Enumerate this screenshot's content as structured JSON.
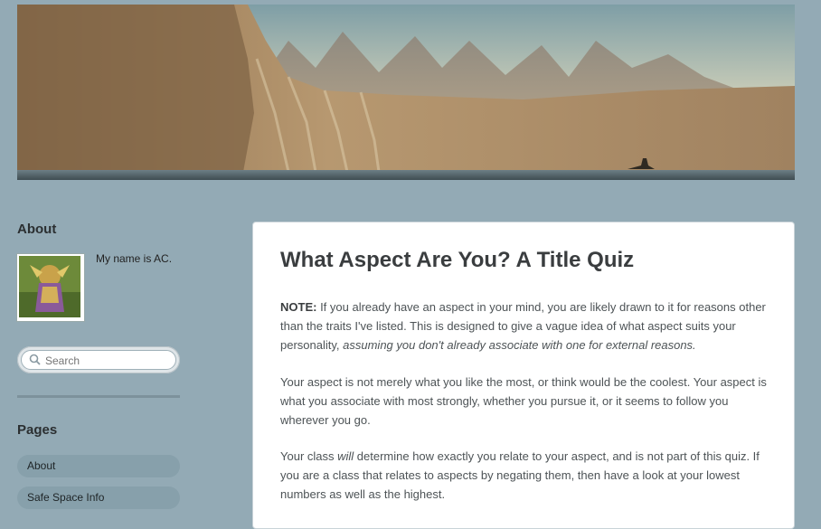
{
  "sidebar": {
    "about_title": "About",
    "about_text": "My name is AC.",
    "search_placeholder": "Search",
    "pages_title": "Pages",
    "pages": [
      {
        "label": "About"
      },
      {
        "label": "Safe Space Info"
      }
    ]
  },
  "post": {
    "title": "What Aspect Are You? A Title Quiz",
    "p1_label": "NOTE:",
    "p1_text": " If you already have an aspect in your mind, you are likely drawn to it for reasons other than the traits I've listed. This is designed to give a vague idea of what aspect suits your personality, ",
    "p1_italic": "assuming you don't already associate with one for external reasons.",
    "p2": "Your aspect is not merely what you like the most, or think would be the coolest. Your aspect is what you associate with most strongly, whether you pursue it, or it seems to follow you wherever you go.",
    "p3_a": "Your class ",
    "p3_italic": "will",
    "p3_b": " determine how exactly you relate to your aspect, and is not part of this quiz. If you are a class that relates to aspects by negating them, then have a look at your lowest numbers as well as the highest."
  },
  "colors": {
    "page_background": "#93aab5",
    "sidebar_link_background": "#87a0ab",
    "content_background": "#ffffff"
  }
}
